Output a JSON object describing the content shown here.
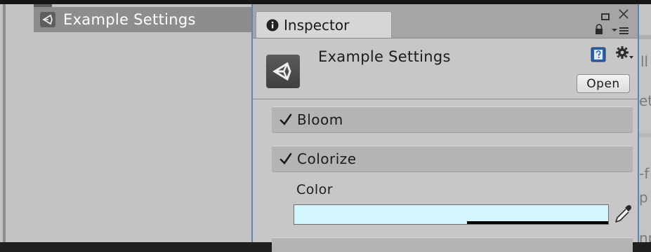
{
  "hierarchy": {
    "selected_item": {
      "label": "Example Settings",
      "icon": "unity-asset-icon"
    }
  },
  "inspector": {
    "tab": {
      "label": "Inspector",
      "icon": "info-icon"
    },
    "window_controls": [
      "maximize-icon",
      "close-icon",
      "lock-icon",
      "menu-icon"
    ],
    "asset": {
      "title": "Example Settings",
      "icon": "unity-asset-icon",
      "open_button": "Open",
      "header_icons": [
        "help-icon",
        "gear-icon"
      ]
    },
    "sections": [
      {
        "label": "Bloom",
        "checked": true
      },
      {
        "label": "Colorize",
        "checked": true
      }
    ],
    "color_field": {
      "label": "Color",
      "value": "#d4f6ff",
      "alpha": 0.55
    }
  },
  "background_window": {
    "fragments": [
      "ll",
      "et",
      "-f",
      "p",
      "np"
    ]
  },
  "colors": {
    "panel_bg": "#c2c2c2",
    "inspector_bg": "#c7c7c7",
    "section_bg": "#b4b4b4",
    "selection": "#8d8d8d",
    "window_border": "#5a88b5"
  }
}
